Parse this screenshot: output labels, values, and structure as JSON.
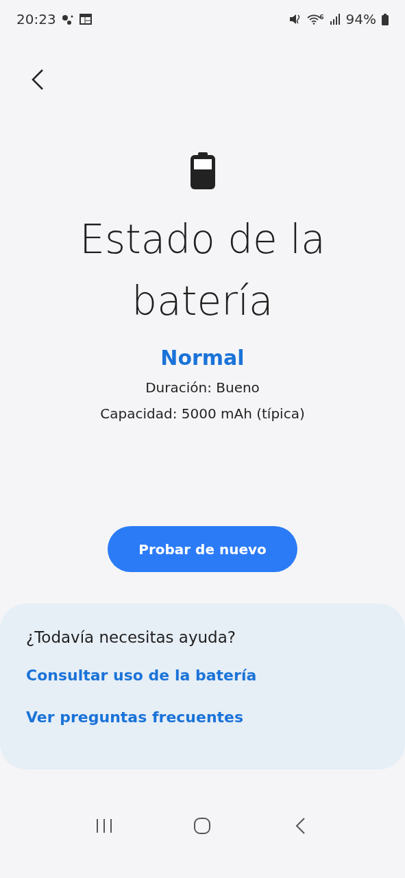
{
  "status_bar": {
    "time": "20:23",
    "wifi_badge": "6",
    "battery": "94%"
  },
  "title": "Estado de la batería",
  "status": "Normal",
  "details": [
    "Duración: Bueno",
    "Capacidad: 5000 mAh (típica)"
  ],
  "button": "Probar de nuevo",
  "help": {
    "title": "¿Todavía necesitas ayuda?",
    "links": [
      "Consultar uso de la batería",
      "Ver preguntas frecuentes"
    ]
  }
}
